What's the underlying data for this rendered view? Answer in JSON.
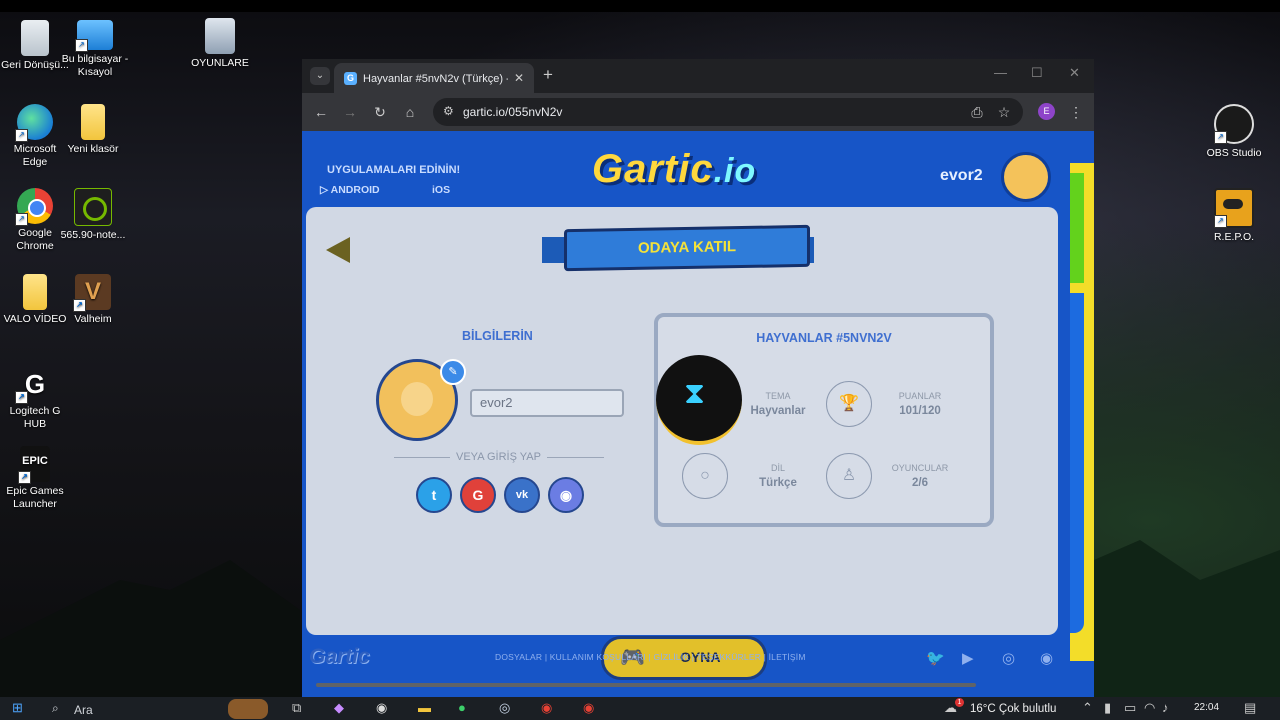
{
  "desktop": {
    "icons": [
      {
        "label": "Geri Dönüşü...",
        "icon": "recycle-bin-icon"
      },
      {
        "label": "Bu bilgisayar - Kısayol",
        "icon": "computer-icon"
      },
      {
        "label": "OYUNLARE",
        "icon": "folder-app-icon"
      },
      {
        "label": "Microsoft Edge",
        "icon": "edge-icon"
      },
      {
        "label": "Yeni klasör",
        "icon": "folder-icon"
      },
      {
        "label": "Google Chrome",
        "icon": "chrome-icon"
      },
      {
        "label": "565.90-note...",
        "icon": "nvidia-icon"
      },
      {
        "label": "VALO VİDEO",
        "icon": "folder-icon"
      },
      {
        "label": "Valheim",
        "icon": "valheim-icon"
      },
      {
        "label": "Logitech G HUB",
        "icon": "logitech-icon"
      },
      {
        "label": "Epic Games Launcher",
        "icon": "epic-icon"
      },
      {
        "label": "OBS Studio",
        "icon": "obs-icon"
      },
      {
        "label": "R.E.P.O.",
        "icon": "repo-icon"
      }
    ],
    "epic_badge": "EPIC"
  },
  "browser": {
    "tab_title": "Hayvanlar #5nvN2v (Türkçe) - G",
    "favicon_letter": "G",
    "url": "gartic.io/055nvN2v",
    "profile_initial": "E"
  },
  "gartic": {
    "apps_title": "UYGULAMALARI EDİNİN!",
    "android_label": "ANDROID",
    "ios_label": "iOS",
    "logo_text": "Gartic",
    "logo_suffix": ".io",
    "username": "evor2",
    "page_title": "ODAYA KATIL",
    "your_info_title": "BİLGİLERİN",
    "nickname_value": "evor2",
    "or_login": "VEYA GİRİŞ YAP",
    "social": [
      "twitter",
      "google",
      "vk",
      "discord"
    ],
    "room": {
      "title": "HAYVANLAR #5NVN2V",
      "theme_label": "TEMA",
      "theme_value": "Hayvanlar",
      "points_label": "PUANLAR",
      "points_value": "101/120",
      "language_label": "DİL",
      "language_value": "Türkçe",
      "players_label": "OYUNCULAR",
      "players_value": "2/6"
    },
    "play_label": "OYNA",
    "footer_logo": "Gartic",
    "footer_links": "DOSYALAR | KULLANIM KOŞULLARI | GİZLİLİK | TEŞEKKÜRLER | İLETİŞİM",
    "footer_social": [
      "twitter",
      "youtube",
      "instagram",
      "discord"
    ]
  },
  "taskbar": {
    "search_placeholder": "Ara",
    "weather": "16°C  Çok bulutlu",
    "weather_badge": "1",
    "time": "22:04"
  }
}
